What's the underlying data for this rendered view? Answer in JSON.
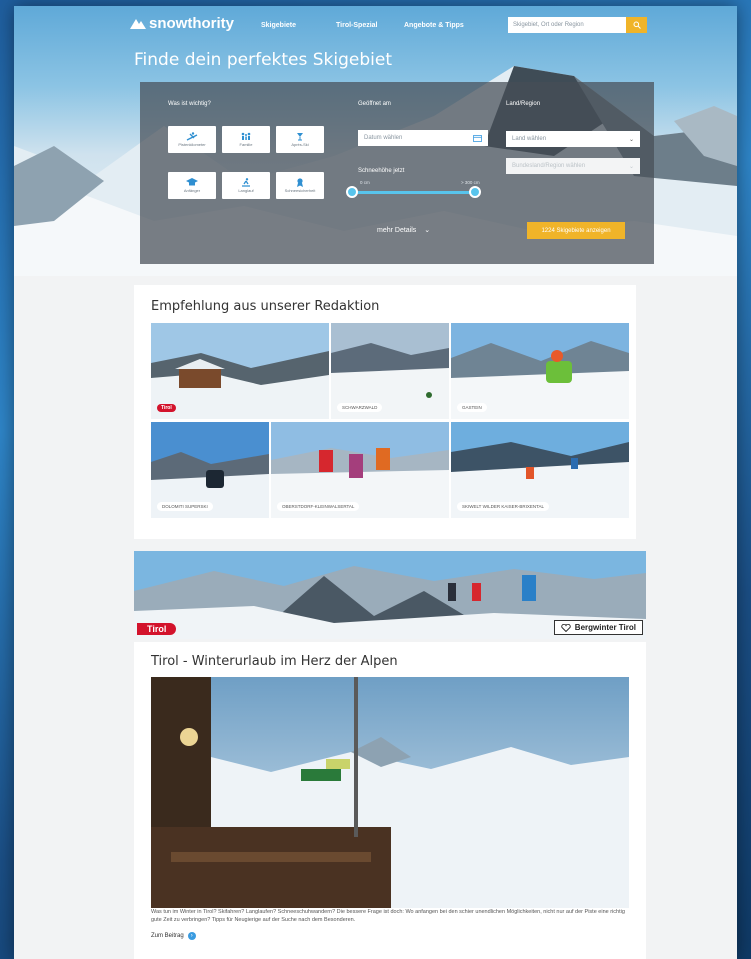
{
  "nav": {
    "logo": "snowthority",
    "links": [
      "Skigebiete",
      "Tirol-Spezial",
      "Angebote & Tipps"
    ],
    "search_placeholder": "Skigebiet, Ort oder Region"
  },
  "hero": {
    "title": "Finde dein perfektes Skigebiet"
  },
  "filter": {
    "what_label": "Was ist wichtig?",
    "tiles": [
      "Pistenkilometer",
      "Familie",
      "Après-Ski",
      "Anfänger",
      "Langlauf",
      "Schneesicherheit"
    ],
    "open_label": "Geöffnet am",
    "date_placeholder": "Datum wählen",
    "snow_label": "Schneehöhe jetzt",
    "snow_min": "0 cm",
    "snow_max": "> 300 cm",
    "country_label": "Land/Region",
    "country_value": "Land wählen",
    "region_value": "Bundesland/Region wählen",
    "more_details": "mehr Details",
    "show_button": "1224 Skigebiete anzeigen"
  },
  "recommend": {
    "title": "Empfehlung aus unserer Redaktion",
    "tiles": [
      "Tirol",
      "SCHWARZWALD",
      "GASTEIN",
      "DOLOMITI SUPERSKI",
      "OBERSTDORF-KLEINWALSERTAL",
      "SKIWELT WILDER KAISER-BRIXENTAL"
    ]
  },
  "banner": {
    "left": "Tirol",
    "right": "Bergwinter Tirol"
  },
  "article": {
    "title": "Tirol - Winterurlaub im Herz der Alpen",
    "text": "Was tun im Winter in Tirol? Skifahren? Langlaufen? Schneeschuhwandern? Die bessere Frage ist doch: Wo anfangen bei den schier unendlichen Möglichkeiten, nicht nur auf der Piste eine richtig gute Zeit zu verbringen? Tipps für Neugierige auf der Suche nach dem Besonderen.",
    "read_more": "Zum Beitrag"
  },
  "colors": {
    "accent": "#f0b429",
    "slider": "#58c4ec",
    "tirol_red": "#d3132c"
  }
}
